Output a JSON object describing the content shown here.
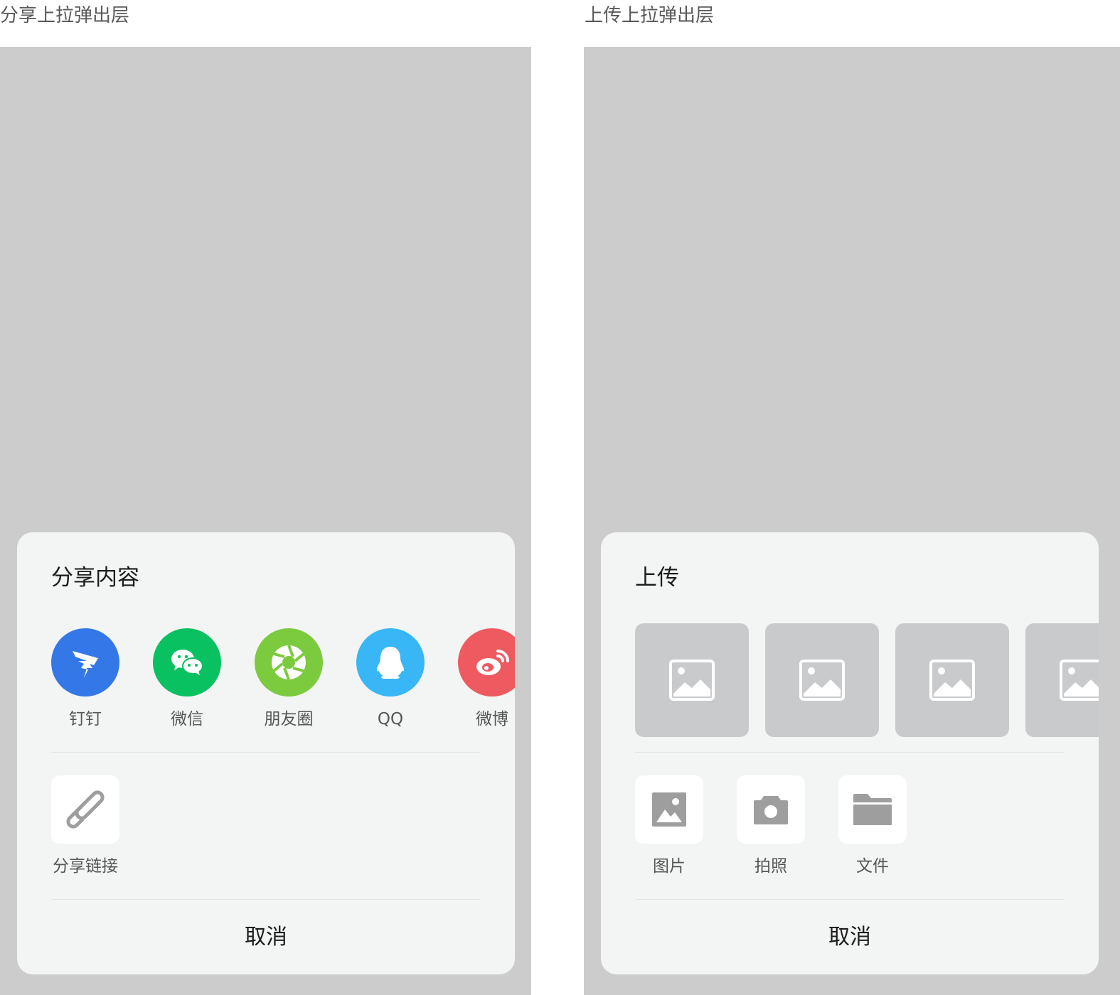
{
  "left": {
    "caption": "分享上拉弹出层",
    "sheet_title": "分享内容",
    "share_targets": [
      {
        "label": "钉钉",
        "icon": "dingtalk-icon",
        "color": "#3478e8"
      },
      {
        "label": "微信",
        "icon": "wechat-icon",
        "color": "#09c160"
      },
      {
        "label": "朋友圈",
        "icon": "moments-icon",
        "color": "#7ccb3f"
      },
      {
        "label": "QQ",
        "icon": "qq-icon",
        "color": "#38b6f5"
      },
      {
        "label": "微博",
        "icon": "weibo-icon",
        "color": "#ee5a60"
      }
    ],
    "link_option": {
      "label": "分享链接",
      "icon": "link-icon"
    },
    "cancel_label": "取消"
  },
  "right": {
    "caption": "上传上拉弹出层",
    "sheet_title": "上传",
    "thumbnails": [
      {
        "icon": "image-placeholder-icon"
      },
      {
        "icon": "image-placeholder-icon"
      },
      {
        "icon": "image-placeholder-icon"
      },
      {
        "icon": "image-placeholder-icon"
      }
    ],
    "options": [
      {
        "label": "图片",
        "icon": "image-icon"
      },
      {
        "label": "拍照",
        "icon": "camera-icon"
      },
      {
        "label": "文件",
        "icon": "folder-icon"
      }
    ],
    "cancel_label": "取消"
  },
  "colors": {
    "overlay": "#cccccc",
    "sheet_background": "#f3f5f5",
    "thumbnail_placeholder": "#c8cacc",
    "option_icon": "#9e9e9e"
  }
}
